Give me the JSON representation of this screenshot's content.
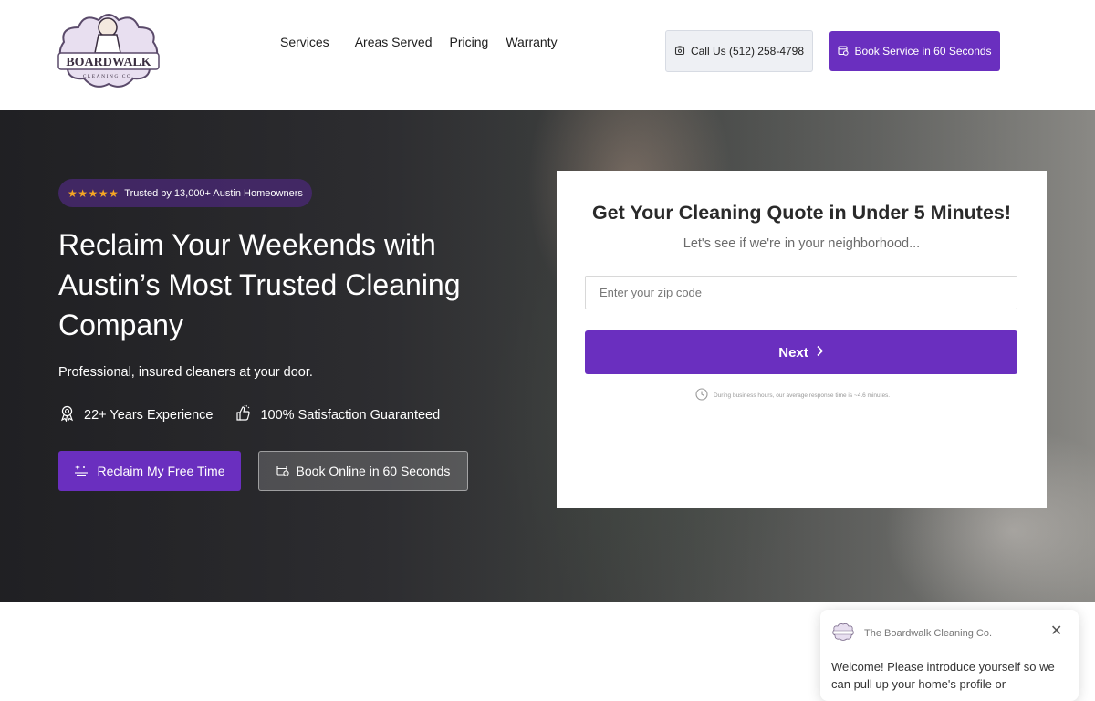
{
  "header": {
    "logo_text": "BOARDWALK",
    "logo_subtext": "CLEANING CO.",
    "nav": [
      {
        "label": "Services",
        "icon": "chevron-down-icon"
      },
      {
        "label": "Areas Served"
      },
      {
        "label": "Pricing"
      },
      {
        "label": "Warranty"
      }
    ],
    "call_button": {
      "label": "Call Us (512) 258-4798",
      "icon": "phone-icon"
    },
    "book_button": {
      "label": "Book Service in 60 Seconds",
      "icon": "calendar-icon"
    }
  },
  "hero": {
    "badge": {
      "stars": "★★★★★",
      "text": "Trusted by 13,000+ Austin Homeowners"
    },
    "title": "Reclaim Your Weekends with Austin’s Most Trusted Cleaning Company",
    "subtitle": "Professional, insured cleaners at your door.",
    "features": [
      {
        "label": "22+ Years Experience",
        "icon": "award-icon"
      },
      {
        "label": "100% Satisfaction Guaranteed",
        "icon": "thumbs-up-icon"
      }
    ],
    "primary_button": {
      "label": "Reclaim My Free Time",
      "icon": "sparkle-icon"
    },
    "secondary_button": {
      "label": "Book Online in 60 Seconds",
      "icon": "calendar-icon"
    }
  },
  "quote_form": {
    "title": "Get Your Cleaning Quote in Under 5 Minutes!",
    "subtitle": "Let's see if we're in your neighborhood...",
    "zip_placeholder": "Enter your zip code",
    "zip_value": "",
    "next_button": "Next",
    "response_note": "During business hours, our average response time is ~4.6 minutes."
  },
  "chat": {
    "company": "The Boardwalk Cleaning Co.",
    "message": "Welcome! Please introduce yourself so we can pull up your home's profile or"
  },
  "colors": {
    "brand_purple": "#6a2fbf",
    "star_gold": "#f5a623"
  }
}
